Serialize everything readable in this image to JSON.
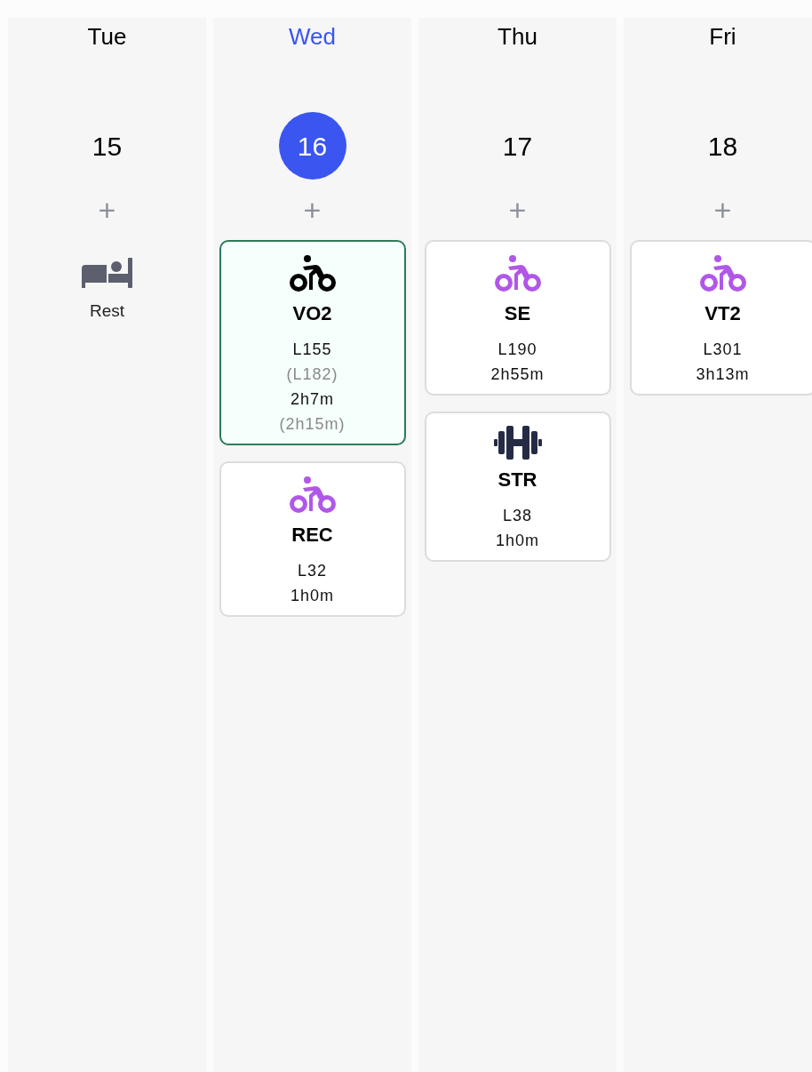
{
  "days": [
    {
      "name": "Tue",
      "date": "15",
      "selected": false,
      "add": "+",
      "items": [
        {
          "kind": "rest",
          "label": "Rest"
        }
      ]
    },
    {
      "name": "Wed",
      "date": "16",
      "selected": true,
      "add": "+",
      "items": [
        {
          "kind": "bike",
          "selected": true,
          "color": "#000000",
          "title": "VO2",
          "lines": [
            {
              "text": "L155",
              "muted": false
            },
            {
              "text": "(L182)",
              "muted": true
            },
            {
              "text": "2h7m",
              "muted": false
            },
            {
              "text": "(2h15m)",
              "muted": true
            }
          ]
        },
        {
          "kind": "bike",
          "selected": false,
          "color": "#b157e8",
          "title": "REC",
          "lines": [
            {
              "text": "L32",
              "muted": false
            },
            {
              "text": "1h0m",
              "muted": false
            }
          ]
        }
      ]
    },
    {
      "name": "Thu",
      "date": "17",
      "selected": false,
      "add": "+",
      "items": [
        {
          "kind": "bike",
          "selected": false,
          "color": "#b157e8",
          "title": "SE",
          "lines": [
            {
              "text": "L190",
              "muted": false
            },
            {
              "text": "2h55m",
              "muted": false
            }
          ]
        },
        {
          "kind": "strength",
          "selected": false,
          "color": "#252b45",
          "title": "STR",
          "lines": [
            {
              "text": "L38",
              "muted": false
            },
            {
              "text": "1h0m",
              "muted": false
            }
          ]
        }
      ]
    },
    {
      "name": "Fri",
      "date": "18",
      "selected": false,
      "add": "+",
      "items": [
        {
          "kind": "bike",
          "selected": false,
          "color": "#b157e8",
          "title": "VT2",
          "lines": [
            {
              "text": "L301",
              "muted": false
            },
            {
              "text": "3h13m",
              "muted": false
            }
          ]
        }
      ]
    }
  ]
}
